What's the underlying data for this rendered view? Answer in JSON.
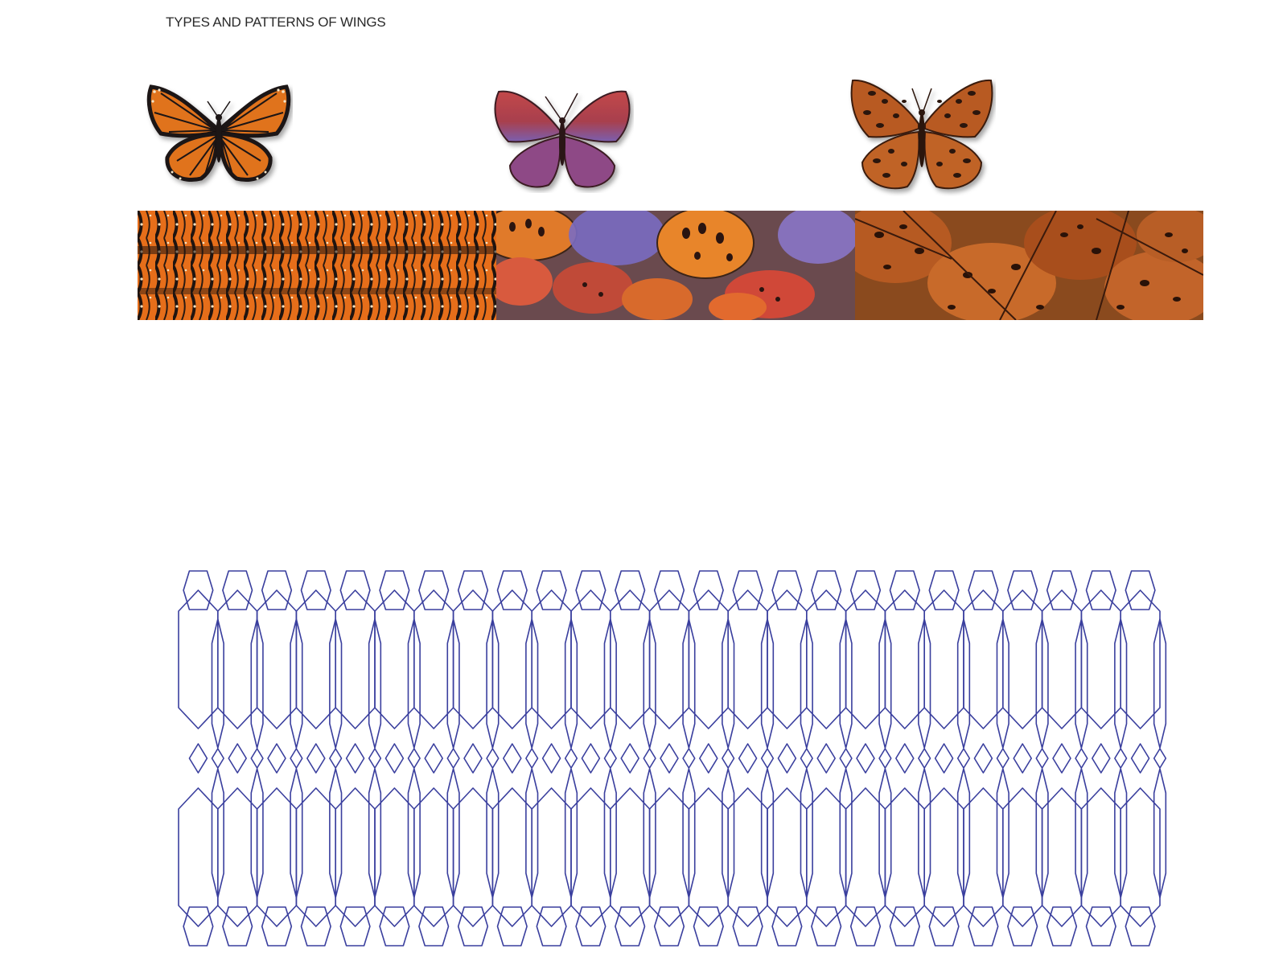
{
  "title": "TYPES AND PATTERNS OF WINGS",
  "colors": {
    "background": "#ffffff",
    "title_text": "#2a2a2a",
    "mesh_line": "#3a3f9e",
    "monarch_orange": "#e0731f",
    "copper_red": "#b5404a",
    "copper_violet": "#7a5fb0",
    "fritillary_orange": "#b85a22",
    "wing_vein": "#1a1212"
  },
  "butterflies": [
    {
      "name": "monarch",
      "icon": "monarch-butterfly-icon"
    },
    {
      "name": "copper",
      "icon": "copper-butterfly-icon"
    },
    {
      "name": "fritillary",
      "icon": "fritillary-butterfly-icon"
    }
  ],
  "pattern_band": [
    {
      "name": "monarch-wing-texture"
    },
    {
      "name": "copper-wing-collage"
    },
    {
      "name": "fritillary-wing-collage"
    }
  ],
  "mesh": {
    "columns": 25,
    "rows": 1
  }
}
